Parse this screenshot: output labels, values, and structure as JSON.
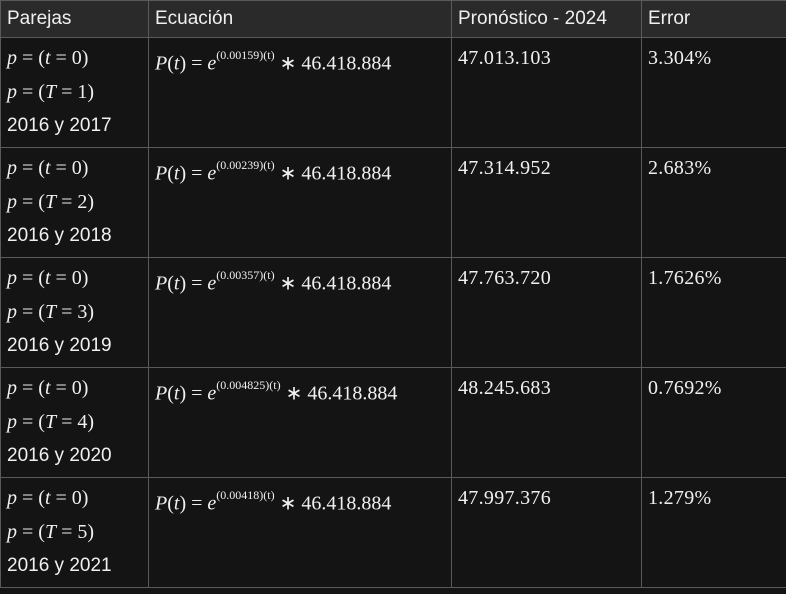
{
  "table": {
    "headers": [
      "Parejas",
      "Ecuación",
      "Pronóstico - 2024",
      "Error"
    ],
    "rows": [
      {
        "pair_line1": "p = (t = 0)",
        "pair_line2": "p = (T = 1)",
        "years": "2016 y 2017",
        "rate": "(0.00159)(t)",
        "base": "46.418.884",
        "forecast": "47.013.103",
        "error": "3.304%"
      },
      {
        "pair_line1": "p = (t = 0)",
        "pair_line2": "p = (T = 2)",
        "years": "2016 y 2018",
        "rate": "(0.00239)(t)",
        "base": "46.418.884",
        "forecast": "47.314.952",
        "error": "2.683%"
      },
      {
        "pair_line1": "p = (t = 0)",
        "pair_line2": "p = (T = 3)",
        "years": "2016 y 2019",
        "rate": "(0.00357)(t)",
        "base": "46.418.884",
        "forecast": "47.763.720",
        "error": "1.7626%"
      },
      {
        "pair_line1": "p = (t = 0)",
        "pair_line2": "p = (T = 4)",
        "years": "2016 y 2020",
        "rate": "(0.004825)(t)",
        "base": "46.418.884",
        "forecast": "48.245.683",
        "error": "0.7692%"
      },
      {
        "pair_line1": "p = (t = 0)",
        "pair_line2": "p = (T = 5)",
        "years": "2016 y 2021",
        "rate": "(0.00418)(t)",
        "base": "46.418.884",
        "forecast": "47.997.376",
        "error": "1.279%"
      }
    ]
  }
}
